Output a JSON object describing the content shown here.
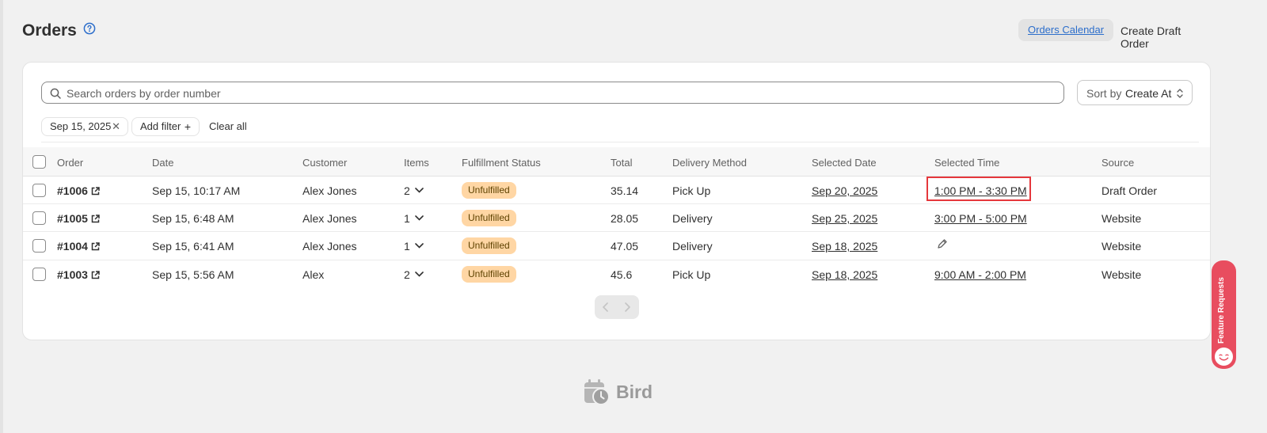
{
  "header": {
    "title": "Orders",
    "orders_calendar_label": "Orders Calendar",
    "create_draft_label": "Create Draft Order"
  },
  "search": {
    "placeholder": "Search orders by order number"
  },
  "sort": {
    "prefix": "Sort by",
    "value": "Create At"
  },
  "filters": {
    "date_chip": "Sep 15, 2025",
    "add_filter": "Add filter",
    "clear_all": "Clear all"
  },
  "columns": {
    "order": "Order",
    "date": "Date",
    "customer": "Customer",
    "items": "Items",
    "fulfillment": "Fulfillment Status",
    "total": "Total",
    "delivery": "Delivery Method",
    "selected_date": "Selected Date",
    "selected_time": "Selected Time",
    "source": "Source"
  },
  "rows": [
    {
      "order": "#1006",
      "date": "Sep 15, 10:17 AM",
      "customer": "Alex Jones",
      "items": "2",
      "status": "Unfulfilled",
      "total": "35.14",
      "delivery": "Pick Up",
      "selected_date": "Sep 20, 2025",
      "selected_time": "1:00 PM - 3:30 PM",
      "source": "Draft Order"
    },
    {
      "order": "#1005",
      "date": "Sep 15, 6:48 AM",
      "customer": "Alex Jones",
      "items": "1",
      "status": "Unfulfilled",
      "total": "28.05",
      "delivery": "Delivery",
      "selected_date": "Sep 25, 2025",
      "selected_time": "3:00 PM - 5:00 PM",
      "source": "Website"
    },
    {
      "order": "#1004",
      "date": "Sep 15, 6:41 AM",
      "customer": "Alex Jones",
      "items": "1",
      "status": "Unfulfilled",
      "total": "47.05",
      "delivery": "Delivery",
      "selected_date": "Sep 18, 2025",
      "selected_time": "",
      "source": "Website"
    },
    {
      "order": "#1003",
      "date": "Sep 15, 5:56 AM",
      "customer": "Alex",
      "items": "2",
      "status": "Unfulfilled",
      "total": "45.6",
      "delivery": "Pick Up",
      "selected_date": "Sep 18, 2025",
      "selected_time": "9:00 AM - 2:00 PM",
      "source": "Website"
    }
  ],
  "footer": {
    "brand": "Bird"
  },
  "feature_tab": {
    "label": "Feature Requests"
  },
  "colors": {
    "accent_link": "#2c6ecb",
    "badge_bg": "#ffd6a4",
    "badge_text": "#5e4200",
    "highlight": "#e5373c",
    "feature_tab": "#e84d5f"
  }
}
